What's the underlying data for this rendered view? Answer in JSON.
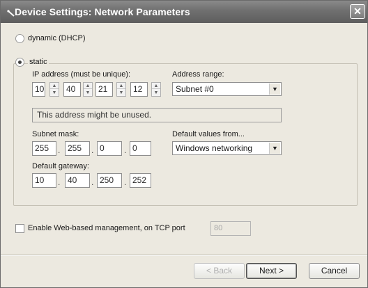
{
  "window": {
    "title": "Device Settings: Network Parameters",
    "close_glyph": "✕"
  },
  "mode": {
    "dhcp_label": "dynamic (DHCP)",
    "static_label": "static",
    "selected": "static"
  },
  "ip": {
    "label": "IP address (must be unique):",
    "octets": [
      "10",
      "40",
      "21",
      "12"
    ]
  },
  "address_range": {
    "label": "Address range:",
    "selected": "Subnet #0"
  },
  "status_message": "This address might be unused.",
  "subnet_mask": {
    "label": "Subnet mask:",
    "octets": [
      "255",
      "255",
      "0",
      "0"
    ]
  },
  "default_values": {
    "label": "Default values from...",
    "selected": "Windows networking"
  },
  "gateway": {
    "label": "Default gateway:",
    "octets": [
      "10",
      "40",
      "250",
      "252"
    ]
  },
  "dot": ".",
  "web_mgmt": {
    "label": "Enable Web-based management, on TCP port",
    "checked": false,
    "port": "80"
  },
  "buttons": {
    "back": "< Back",
    "next": "Next >",
    "cancel": "Cancel"
  },
  "icons": {
    "title": "wizard-wand-icon",
    "close": "close-icon",
    "dropdown": "chevron-down-icon",
    "spin_up": "arrow-up-icon",
    "spin_down": "arrow-down-icon"
  }
}
